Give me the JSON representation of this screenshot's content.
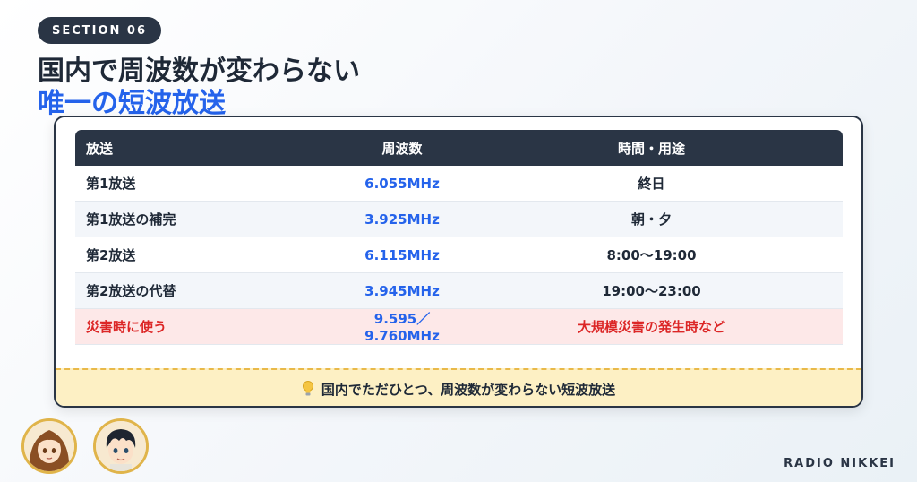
{
  "section_label": "SECTION 06",
  "title_line1": "国内で周波数が変わらない",
  "title_line2": "唯一の短波放送",
  "colors": {
    "accent": "#2563eb",
    "alert": "#dc2626",
    "dark": "#2a3545",
    "note_bg": "#fdf0c4"
  },
  "table": {
    "headers": [
      "放送",
      "周波数",
      "時間・用途"
    ],
    "rows": [
      {
        "name": "第1放送",
        "freq": "6.055MHz",
        "time": "終日"
      },
      {
        "name": "第1放送の補完",
        "freq": "3.925MHz",
        "time": "朝・夕"
      },
      {
        "name": "第2放送",
        "freq": "6.115MHz",
        "time": "8:00〜19:00"
      },
      {
        "name": "第2放送の代替",
        "freq": "3.945MHz",
        "time": "19:00〜23:00"
      },
      {
        "name": "災害時に使う",
        "freq": "9.595／9.760MHz",
        "time": "大規模災害の発生時など"
      }
    ]
  },
  "note": {
    "icon": "lightbulb-icon",
    "text": "国内でただひとつ、周波数が変わらない短波放送"
  },
  "brand": "RADIO NIKKEI"
}
